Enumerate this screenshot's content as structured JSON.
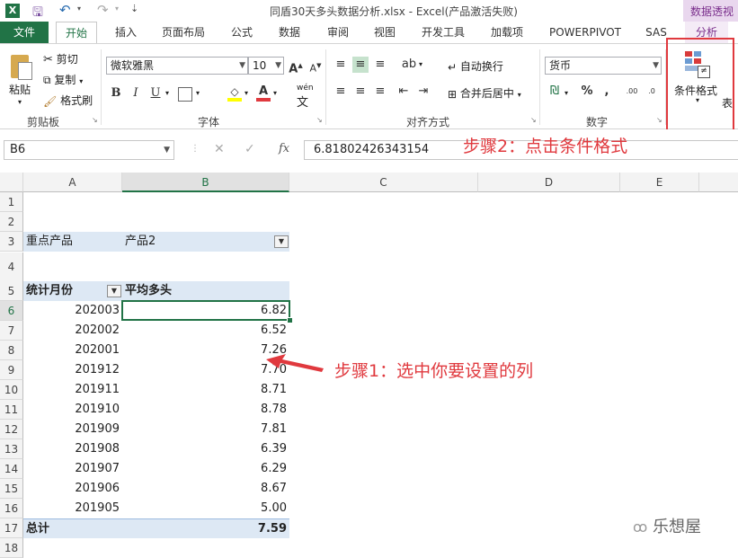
{
  "window": {
    "title": "同盾30天多头数据分析.xlsx - Excel(产品激活失败)",
    "context_tab": "数据透视"
  },
  "tabs": [
    "文件",
    "开始",
    "插入",
    "页面布局",
    "公式",
    "数据",
    "审阅",
    "视图",
    "开发工具",
    "加载项",
    "POWERPIVOT",
    "SAS",
    "分析"
  ],
  "ribbon": {
    "clipboard": {
      "paste": "粘贴",
      "cut": "剪切",
      "copy": "复制",
      "format_painter": "格式刷",
      "label": "剪贴板"
    },
    "font": {
      "family": "微软雅黑",
      "size": "10",
      "bold": "B",
      "italic": "I",
      "underline": "U",
      "phonetic": "wén",
      "label": "字体"
    },
    "alignment": {
      "wrap": "自动换行",
      "merge": "合并后居中",
      "label": "对齐方式"
    },
    "number": {
      "format": "货币",
      "percent": "%",
      "comma": ",",
      "label": "数字"
    },
    "styles": {
      "conditional_format": "条件格式",
      "table_partial": "表"
    }
  },
  "formula_bar": {
    "name_box": "B6",
    "formula": "6.81802426343154",
    "cancel": "✕",
    "enter": "✓",
    "fx": "fx"
  },
  "columns": [
    "A",
    "B",
    "C",
    "D",
    "E"
  ],
  "rows": [
    "1",
    "2",
    "3",
    "4",
    "5",
    "6",
    "7",
    "8",
    "9",
    "10",
    "11",
    "12",
    "13",
    "14",
    "15",
    "16",
    "17",
    "18"
  ],
  "pivot": {
    "filter_label": "重点产品",
    "filter_value": "产品2",
    "header_month": "统计月份",
    "header_value": "平均多头",
    "data": [
      {
        "month": "202003",
        "value": "6.82"
      },
      {
        "month": "202002",
        "value": "6.52"
      },
      {
        "month": "202001",
        "value": "7.26"
      },
      {
        "month": "201912",
        "value": "7.70"
      },
      {
        "month": "201911",
        "value": "8.71"
      },
      {
        "month": "201910",
        "value": "8.78"
      },
      {
        "month": "201909",
        "value": "7.81"
      },
      {
        "month": "201908",
        "value": "6.39"
      },
      {
        "month": "201907",
        "value": "6.29"
      },
      {
        "month": "201906",
        "value": "8.67"
      },
      {
        "month": "201905",
        "value": "5.00"
      }
    ],
    "total_label": "总计",
    "total_value": "7.59"
  },
  "annotations": {
    "step1": "步骤1：选中你要设置的列",
    "step2": "步骤2：点击条件格式"
  },
  "watermark": "乐想屋",
  "colors": {
    "excel_green": "#217346",
    "annotation_red": "#e0393e",
    "pivot_blue": "#dde8f4"
  }
}
